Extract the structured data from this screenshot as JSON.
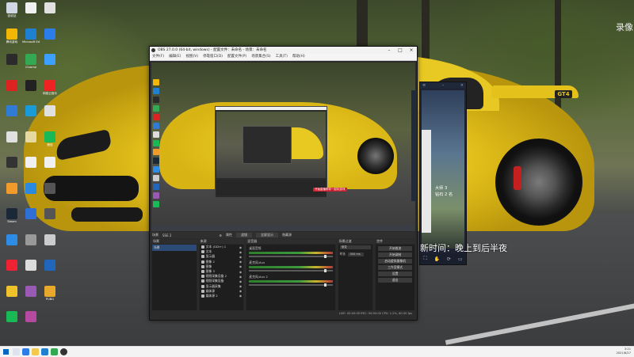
{
  "desktop": {
    "corner_text": "录像",
    "overlay_text": "新时间：晚上到后半夜",
    "icons": [
      {
        "name": "回收站",
        "color": "#cfd8e3"
      },
      {
        "name": "",
        "color": "#f0f0f0"
      },
      {
        "name": "",
        "color": "#e0e0e0"
      },
      {
        "name": "腾讯游戏",
        "color": "#f2b705"
      },
      {
        "name": "Microsoft Edge",
        "color": "#1f7fd1"
      },
      {
        "name": "",
        "color": "#2b7de9"
      },
      {
        "name": "",
        "color": "#2b2b2b"
      },
      {
        "name": "Chrome",
        "color": "#34a853"
      },
      {
        "name": "",
        "color": "#3da0ff"
      },
      {
        "name": "",
        "color": "#d22"
      },
      {
        "name": "",
        "color": "#222"
      },
      {
        "name": "网易云音乐",
        "color": "#e22"
      },
      {
        "name": "",
        "color": "#2f7bd6"
      },
      {
        "name": "",
        "color": "#1b9ad8"
      },
      {
        "name": "",
        "color": "#e0e0e0"
      },
      {
        "name": "",
        "color": "#e0e0e0"
      },
      {
        "name": "",
        "color": "#e4d9a0"
      },
      {
        "name": "微信",
        "color": "#19b955"
      },
      {
        "name": "",
        "color": "#333"
      },
      {
        "name": "",
        "color": "#f0f0f0"
      },
      {
        "name": "",
        "color": "#f0f0f0"
      },
      {
        "name": "",
        "color": "#f29b2b"
      },
      {
        "name": "",
        "color": "#2b8ae0"
      },
      {
        "name": "",
        "color": "#555"
      },
      {
        "name": "Steam",
        "color": "#1b2838"
      },
      {
        "name": "",
        "color": "#2f6fd6"
      },
      {
        "name": "",
        "color": "#555"
      },
      {
        "name": "",
        "color": "#2d8ce6"
      },
      {
        "name": "",
        "color": "#999"
      },
      {
        "name": "",
        "color": "#ccc"
      },
      {
        "name": "",
        "color": "#e23"
      },
      {
        "name": "",
        "color": "#dcdcdc"
      },
      {
        "name": "",
        "color": "#2266bb"
      },
      {
        "name": "",
        "color": "#efc12a"
      },
      {
        "name": "",
        "color": "#9b59b6"
      },
      {
        "name": "PUBG",
        "color": "#e9a72b"
      },
      {
        "name": "",
        "color": "#19b955"
      },
      {
        "name": "",
        "color": "#b54aa0"
      }
    ]
  },
  "obs": {
    "title": "OBS 27.0.0 (64-bit, windows) - 配置文件：未命名 - 场景：未命名",
    "menu": [
      "文件(F)",
      "编辑(E)",
      "视图(V)",
      "停靠窗口(D)",
      "配置文件(P)",
      "场景集合(S)",
      "工具(T)",
      "帮助(H)"
    ],
    "scene_bar": {
      "label": "场景",
      "value": "SSE 2",
      "btn1": "属性",
      "btn2": "滤镜",
      "btn3": "全屏显示",
      "hint": "隐藏源"
    },
    "docks": {
      "scenes": {
        "header": "场景",
        "items": [
          "场景"
        ]
      },
      "sources": {
        "header": "来源",
        "items": [
          "文本 (GDI+) 1",
          "文本",
          "显示器",
          "图像 2",
          "图像",
          "图像 3",
          "视频采集设备 2",
          "视频采集设备",
          "显示器采集",
          "媒体源",
          "媒体源 2"
        ]
      },
      "mixer": {
        "header": "混音器",
        "channels": [
          {
            "name": "桌面音频"
          },
          {
            "name": "麦克风/Aux"
          },
          {
            "name": "麦克风/Aux 2"
          }
        ]
      },
      "transitions": {
        "header": "场景过渡",
        "type": "渐变",
        "duration_label": "时长",
        "duration": "300 ms"
      },
      "controls": {
        "header": "控件",
        "buttons": [
          "开始推流",
          "开始录制",
          "启动虚拟摄像机",
          "工作室模式",
          "设置",
          "退出"
        ]
      }
    },
    "status": "LIVE: 00:00:00   REC: 00:00:00   CPU: 1.2%, 60.00 fps"
  },
  "phone": {
    "line1": "大师 3",
    "line2": "钻石 2 名"
  },
  "preview": {
    "red_label": "开始直播带你一起玩游戏"
  },
  "taskbar": {
    "time": "3:21",
    "date": "2021/8/27"
  }
}
